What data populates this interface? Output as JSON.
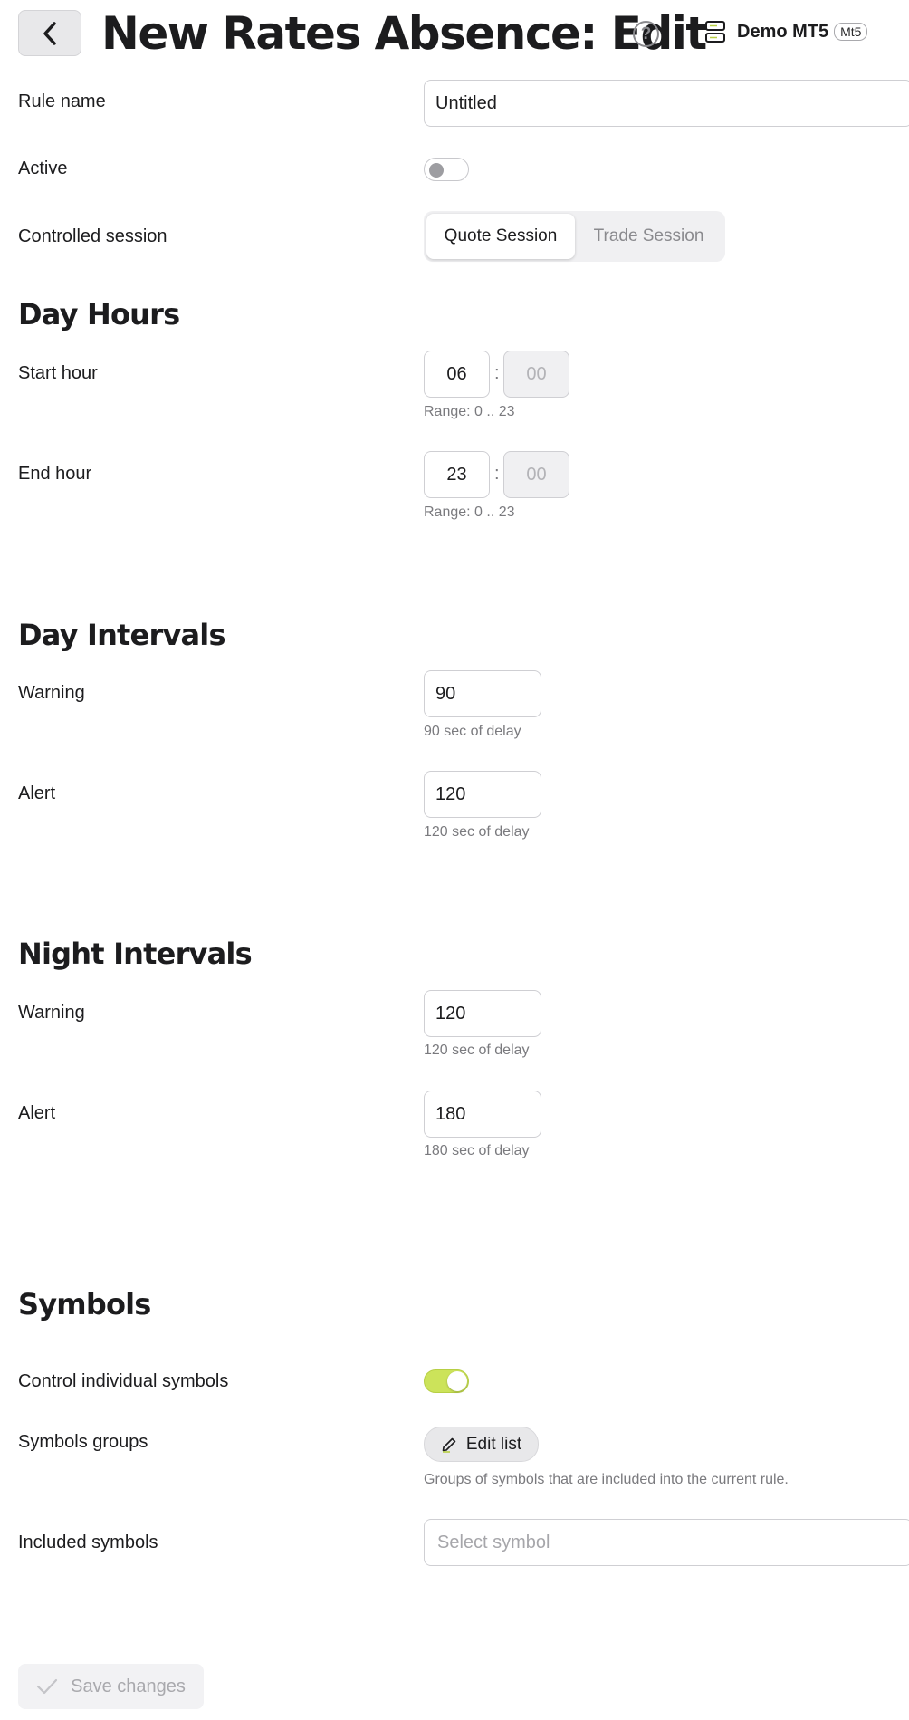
{
  "header": {
    "title": "New Rates Absence: Edit",
    "help_icon": "?",
    "server_name": "Demo MT5",
    "server_badge": "Mt5"
  },
  "general": {
    "rule_name_label": "Rule name",
    "rule_name_value": "Untitled",
    "active_label": "Active",
    "active_value": false,
    "session_label": "Controlled session",
    "session_options": [
      "Quote Session",
      "Trade Session"
    ],
    "session_selected": "Quote Session"
  },
  "day_hours": {
    "title": "Day Hours",
    "start_label": "Start hour",
    "start_hour": "06",
    "start_minute": "00",
    "start_hint": "Range: 0 .. 23",
    "end_label": "End hour",
    "end_hour": "23",
    "end_minute": "00",
    "end_hint": "Range: 0 .. 23",
    "separator": ":"
  },
  "day_intervals": {
    "title": "Day Intervals",
    "warning_label": "Warning",
    "warning_value": "90",
    "warning_hint": "90 sec of delay",
    "alert_label": "Alert",
    "alert_value": "120",
    "alert_hint": "120 sec of delay"
  },
  "night_intervals": {
    "title": "Night Intervals",
    "warning_label": "Warning",
    "warning_value": "120",
    "warning_hint": "120 sec of delay",
    "alert_label": "Alert",
    "alert_value": "180",
    "alert_hint": "180 sec of delay"
  },
  "symbols": {
    "title": "Symbols",
    "control_label": "Control individual symbols",
    "control_value": true,
    "groups_label": "Symbols groups",
    "edit_list_label": "Edit list",
    "groups_hint": "Groups of symbols that are included into the current rule.",
    "included_label": "Included symbols",
    "included_placeholder": "Select symbol"
  },
  "footer": {
    "save_label": "Save changes"
  },
  "colors": {
    "accent": "#cce35a",
    "text": "#1c1c1e",
    "muted": "#7a7a7e"
  }
}
